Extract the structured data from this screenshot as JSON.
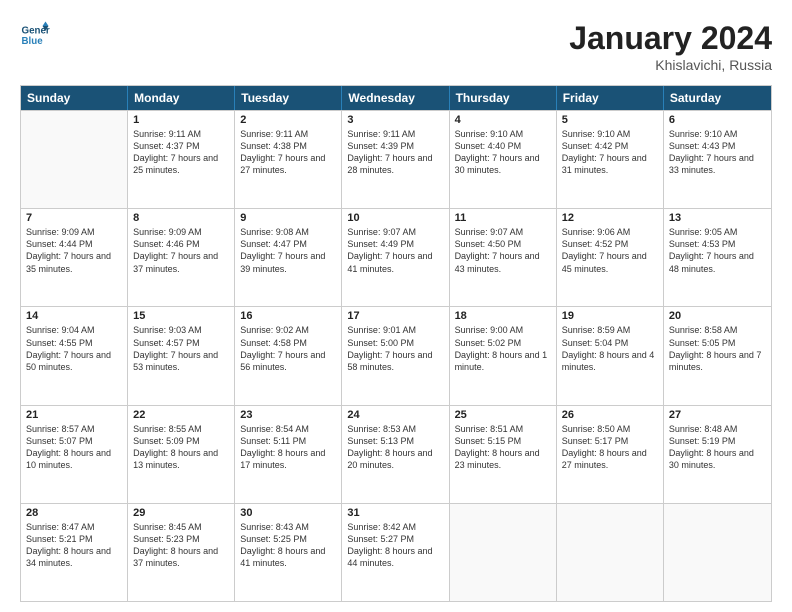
{
  "header": {
    "logo_line1": "General",
    "logo_line2": "Blue",
    "title": "January 2024",
    "location": "Khislavichi, Russia"
  },
  "weekdays": [
    "Sunday",
    "Monday",
    "Tuesday",
    "Wednesday",
    "Thursday",
    "Friday",
    "Saturday"
  ],
  "rows": [
    [
      {
        "day": "",
        "sunrise": "",
        "sunset": "",
        "daylight": ""
      },
      {
        "day": "1",
        "sunrise": "Sunrise: 9:11 AM",
        "sunset": "Sunset: 4:37 PM",
        "daylight": "Daylight: 7 hours and 25 minutes."
      },
      {
        "day": "2",
        "sunrise": "Sunrise: 9:11 AM",
        "sunset": "Sunset: 4:38 PM",
        "daylight": "Daylight: 7 hours and 27 minutes."
      },
      {
        "day": "3",
        "sunrise": "Sunrise: 9:11 AM",
        "sunset": "Sunset: 4:39 PM",
        "daylight": "Daylight: 7 hours and 28 minutes."
      },
      {
        "day": "4",
        "sunrise": "Sunrise: 9:10 AM",
        "sunset": "Sunset: 4:40 PM",
        "daylight": "Daylight: 7 hours and 30 minutes."
      },
      {
        "day": "5",
        "sunrise": "Sunrise: 9:10 AM",
        "sunset": "Sunset: 4:42 PM",
        "daylight": "Daylight: 7 hours and 31 minutes."
      },
      {
        "day": "6",
        "sunrise": "Sunrise: 9:10 AM",
        "sunset": "Sunset: 4:43 PM",
        "daylight": "Daylight: 7 hours and 33 minutes."
      }
    ],
    [
      {
        "day": "7",
        "sunrise": "Sunrise: 9:09 AM",
        "sunset": "Sunset: 4:44 PM",
        "daylight": "Daylight: 7 hours and 35 minutes."
      },
      {
        "day": "8",
        "sunrise": "Sunrise: 9:09 AM",
        "sunset": "Sunset: 4:46 PM",
        "daylight": "Daylight: 7 hours and 37 minutes."
      },
      {
        "day": "9",
        "sunrise": "Sunrise: 9:08 AM",
        "sunset": "Sunset: 4:47 PM",
        "daylight": "Daylight: 7 hours and 39 minutes."
      },
      {
        "day": "10",
        "sunrise": "Sunrise: 9:07 AM",
        "sunset": "Sunset: 4:49 PM",
        "daylight": "Daylight: 7 hours and 41 minutes."
      },
      {
        "day": "11",
        "sunrise": "Sunrise: 9:07 AM",
        "sunset": "Sunset: 4:50 PM",
        "daylight": "Daylight: 7 hours and 43 minutes."
      },
      {
        "day": "12",
        "sunrise": "Sunrise: 9:06 AM",
        "sunset": "Sunset: 4:52 PM",
        "daylight": "Daylight: 7 hours and 45 minutes."
      },
      {
        "day": "13",
        "sunrise": "Sunrise: 9:05 AM",
        "sunset": "Sunset: 4:53 PM",
        "daylight": "Daylight: 7 hours and 48 minutes."
      }
    ],
    [
      {
        "day": "14",
        "sunrise": "Sunrise: 9:04 AM",
        "sunset": "Sunset: 4:55 PM",
        "daylight": "Daylight: 7 hours and 50 minutes."
      },
      {
        "day": "15",
        "sunrise": "Sunrise: 9:03 AM",
        "sunset": "Sunset: 4:57 PM",
        "daylight": "Daylight: 7 hours and 53 minutes."
      },
      {
        "day": "16",
        "sunrise": "Sunrise: 9:02 AM",
        "sunset": "Sunset: 4:58 PM",
        "daylight": "Daylight: 7 hours and 56 minutes."
      },
      {
        "day": "17",
        "sunrise": "Sunrise: 9:01 AM",
        "sunset": "Sunset: 5:00 PM",
        "daylight": "Daylight: 7 hours and 58 minutes."
      },
      {
        "day": "18",
        "sunrise": "Sunrise: 9:00 AM",
        "sunset": "Sunset: 5:02 PM",
        "daylight": "Daylight: 8 hours and 1 minute."
      },
      {
        "day": "19",
        "sunrise": "Sunrise: 8:59 AM",
        "sunset": "Sunset: 5:04 PM",
        "daylight": "Daylight: 8 hours and 4 minutes."
      },
      {
        "day": "20",
        "sunrise": "Sunrise: 8:58 AM",
        "sunset": "Sunset: 5:05 PM",
        "daylight": "Daylight: 8 hours and 7 minutes."
      }
    ],
    [
      {
        "day": "21",
        "sunrise": "Sunrise: 8:57 AM",
        "sunset": "Sunset: 5:07 PM",
        "daylight": "Daylight: 8 hours and 10 minutes."
      },
      {
        "day": "22",
        "sunrise": "Sunrise: 8:55 AM",
        "sunset": "Sunset: 5:09 PM",
        "daylight": "Daylight: 8 hours and 13 minutes."
      },
      {
        "day": "23",
        "sunrise": "Sunrise: 8:54 AM",
        "sunset": "Sunset: 5:11 PM",
        "daylight": "Daylight: 8 hours and 17 minutes."
      },
      {
        "day": "24",
        "sunrise": "Sunrise: 8:53 AM",
        "sunset": "Sunset: 5:13 PM",
        "daylight": "Daylight: 8 hours and 20 minutes."
      },
      {
        "day": "25",
        "sunrise": "Sunrise: 8:51 AM",
        "sunset": "Sunset: 5:15 PM",
        "daylight": "Daylight: 8 hours and 23 minutes."
      },
      {
        "day": "26",
        "sunrise": "Sunrise: 8:50 AM",
        "sunset": "Sunset: 5:17 PM",
        "daylight": "Daylight: 8 hours and 27 minutes."
      },
      {
        "day": "27",
        "sunrise": "Sunrise: 8:48 AM",
        "sunset": "Sunset: 5:19 PM",
        "daylight": "Daylight: 8 hours and 30 minutes."
      }
    ],
    [
      {
        "day": "28",
        "sunrise": "Sunrise: 8:47 AM",
        "sunset": "Sunset: 5:21 PM",
        "daylight": "Daylight: 8 hours and 34 minutes."
      },
      {
        "day": "29",
        "sunrise": "Sunrise: 8:45 AM",
        "sunset": "Sunset: 5:23 PM",
        "daylight": "Daylight: 8 hours and 37 minutes."
      },
      {
        "day": "30",
        "sunrise": "Sunrise: 8:43 AM",
        "sunset": "Sunset: 5:25 PM",
        "daylight": "Daylight: 8 hours and 41 minutes."
      },
      {
        "day": "31",
        "sunrise": "Sunrise: 8:42 AM",
        "sunset": "Sunset: 5:27 PM",
        "daylight": "Daylight: 8 hours and 44 minutes."
      },
      {
        "day": "",
        "sunrise": "",
        "sunset": "",
        "daylight": ""
      },
      {
        "day": "",
        "sunrise": "",
        "sunset": "",
        "daylight": ""
      },
      {
        "day": "",
        "sunrise": "",
        "sunset": "",
        "daylight": ""
      }
    ]
  ]
}
